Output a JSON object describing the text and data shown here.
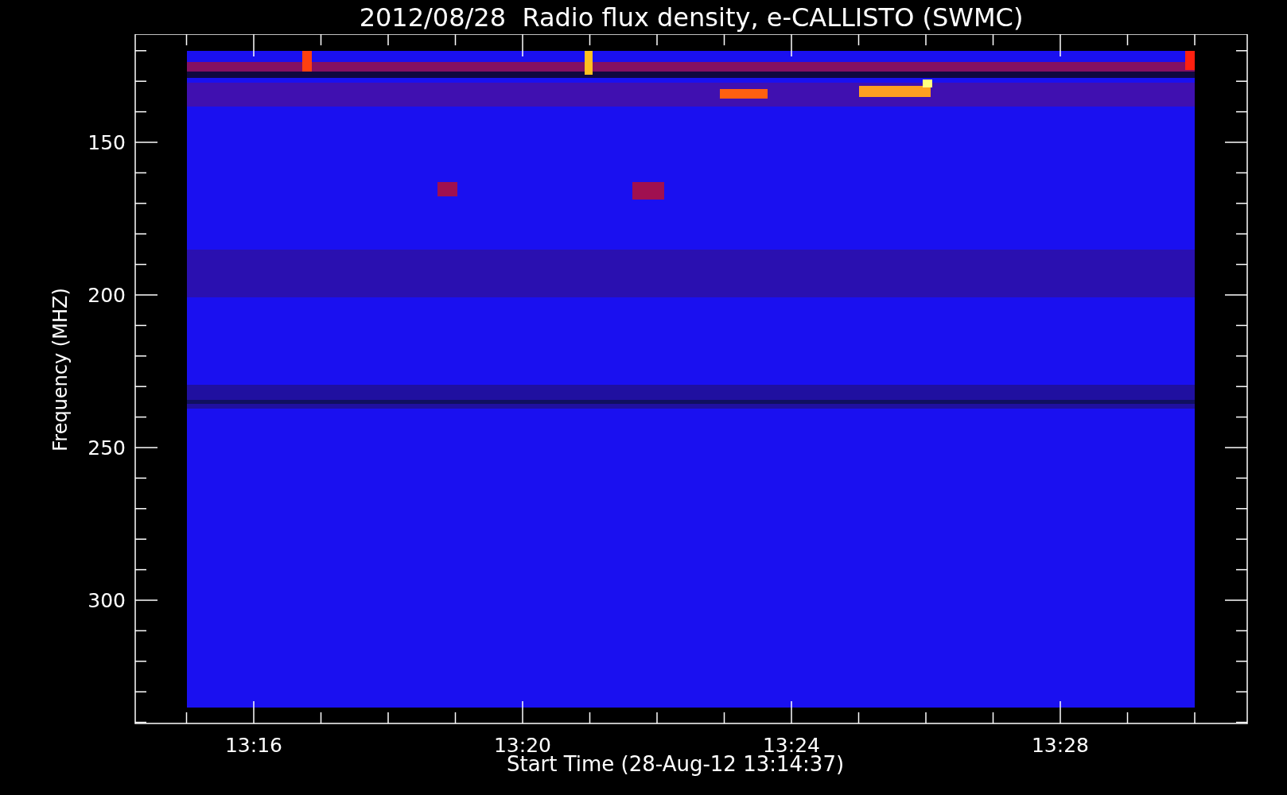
{
  "title": "2012/08/28  Radio flux density, e-CALLISTO (SWMC)",
  "y_axis": {
    "label": "Frequency (MHZ)",
    "ticks": [
      "150",
      "200",
      "250",
      "300"
    ]
  },
  "x_axis": {
    "label": "Start Time (28-Aug-12 13:14:37)",
    "ticks": [
      "13:16",
      "13:20",
      "13:24",
      "13:28"
    ]
  }
}
